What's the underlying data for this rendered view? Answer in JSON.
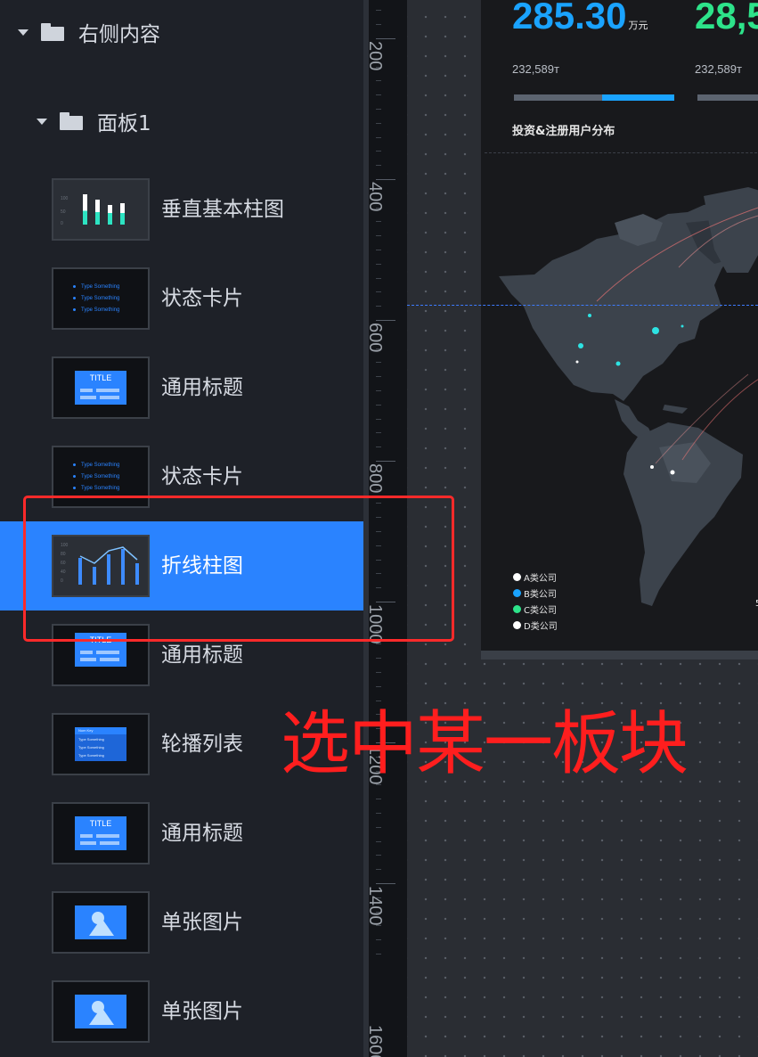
{
  "layer_panel": {
    "group": {
      "label": "右侧内容"
    },
    "subgroup": {
      "label": "面板1"
    },
    "items": [
      {
        "label": "垂直基本柱图",
        "thumb": "bar-chart"
      },
      {
        "label": "状态卡片",
        "thumb": "status-card"
      },
      {
        "label": "通用标题",
        "thumb": "title"
      },
      {
        "label": "状态卡片",
        "thumb": "status-card"
      },
      {
        "label": "折线柱图",
        "thumb": "line-bar",
        "selected": true
      },
      {
        "label": "通用标题",
        "thumb": "title"
      },
      {
        "label": "轮播列表",
        "thumb": "carousel-list"
      },
      {
        "label": "通用标题",
        "thumb": "title"
      },
      {
        "label": "单张图片",
        "thumb": "image"
      },
      {
        "label": "单张图片",
        "thumb": "image"
      }
    ],
    "thumb_text": {
      "title": "TITLE",
      "status_line": "Type Something",
      "list_header": "Num   Key",
      "list_row": "Type Something",
      "bar_axis": [
        "100",
        "50",
        "0"
      ],
      "line_bar_axis": [
        "100",
        "80",
        "60",
        "40",
        "0"
      ]
    }
  },
  "ruler": {
    "labels": [
      "200",
      "400",
      "600",
      "800",
      "1000",
      "1200",
      "1400",
      "1600"
    ]
  },
  "dashboard": {
    "stat_1": {
      "value": "285.30",
      "unit": "万元",
      "sub": "232,589т",
      "progress": 0.45,
      "color": "#1aa3ff"
    },
    "stat_2": {
      "value": "28,5",
      "sub": "232,589т",
      "color": "#2de38a"
    },
    "map_title": "投资&注册用户分布",
    "legend": [
      {
        "label": "A类公司",
        "color": "#ffffff"
      },
      {
        "label": "B类公司",
        "color": "#1aa3ff"
      },
      {
        "label": "C类公司",
        "color": "#2de38a"
      },
      {
        "label": "D类公司",
        "color": "#ffffff"
      }
    ],
    "edge_digit": "5"
  },
  "annotation": {
    "text": "选中某一板块",
    "color": "#ff1e1e"
  }
}
